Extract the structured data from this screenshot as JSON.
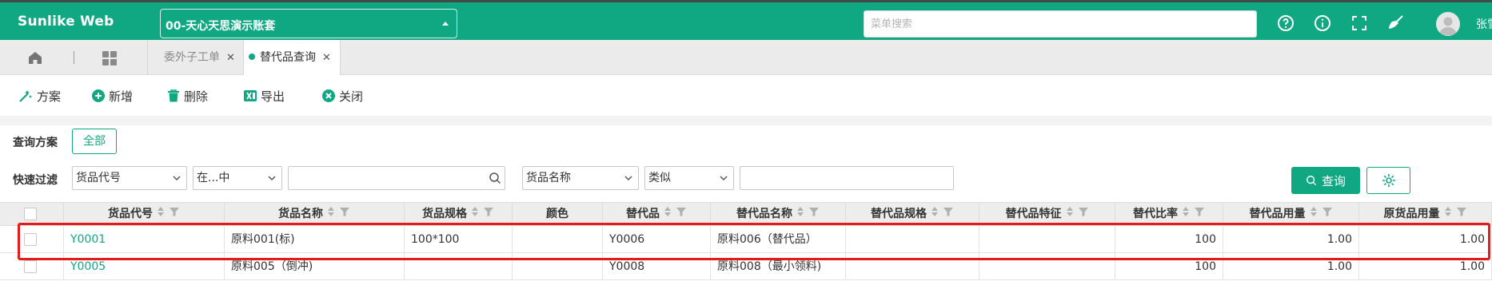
{
  "header": {
    "logo": "Sunlike Web",
    "account": "00-天心天思演示账套",
    "search_placeholder": "菜单搜索",
    "user": "张雪"
  },
  "tabs": [
    {
      "label": "委外子工单"
    },
    {
      "label": "替代品查询"
    }
  ],
  "toolbar": {
    "plan": "方案",
    "add": "新增",
    "delete": "删除",
    "export": "导出",
    "close": "关闭"
  },
  "filter": {
    "plan_label": "查询方案",
    "plan_all": "全部",
    "quick_label": "快速过滤",
    "field1": "货品代号",
    "op1": "在...中",
    "value1": "",
    "field2": "货品名称",
    "op2": "类似",
    "value2": "",
    "query_button": "查询"
  },
  "table": {
    "columns": [
      "货品代号",
      "货品名称",
      "货品规格",
      "颜色",
      "替代品",
      "替代品名称",
      "替代品规格",
      "替代品特征",
      "替代比率",
      "替代品用量",
      "原货品用量"
    ],
    "rows": [
      [
        "Y0001",
        "原料001(标)",
        "100*100",
        "",
        "Y0006",
        "原料006（替代品）",
        "",
        "",
        "100",
        "1.00",
        "1.00"
      ],
      [
        "Y0005",
        "原料005（倒冲)",
        "",
        "",
        "Y0008",
        "原料008（最小领料)",
        "",
        "",
        "100",
        "1.00",
        "1.00"
      ]
    ]
  },
  "colors": {
    "brand": "#10a882",
    "highlight": "#e31b1b"
  }
}
